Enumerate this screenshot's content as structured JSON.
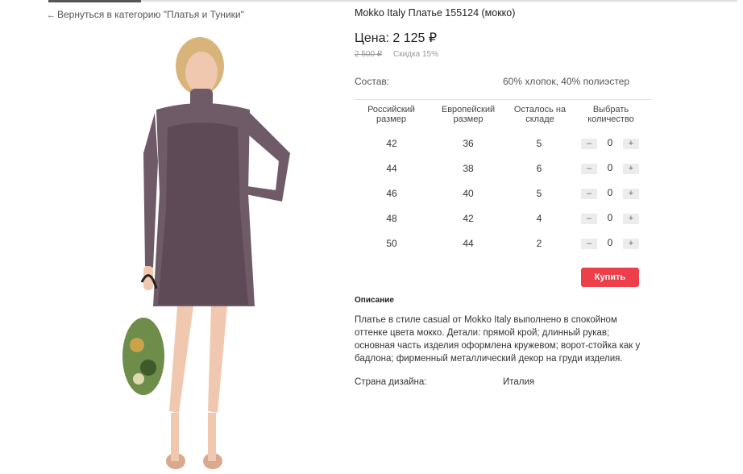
{
  "nav": {
    "back_label": "Вернуться в категорию \"Платья и Туники\""
  },
  "product": {
    "title": "Mokko Italy Платье 155124 (мокко)",
    "price": "Цена: 2 125 ₽",
    "old_price": "2 500 ₽",
    "discount": "Скидка 15%",
    "composition_label": "Состав:",
    "composition_value": "60% хлопок, 40% полиэстер",
    "dress_color": "#6f5a67"
  },
  "sizes_table": {
    "headers": [
      "Российский размер",
      "Европейский размер",
      "Осталось на складе",
      "Выбрать количество"
    ],
    "rows": [
      {
        "ru": "42",
        "eu": "36",
        "stock": "5",
        "qty": "0"
      },
      {
        "ru": "44",
        "eu": "38",
        "stock": "6",
        "qty": "0"
      },
      {
        "ru": "46",
        "eu": "40",
        "stock": "5",
        "qty": "0"
      },
      {
        "ru": "48",
        "eu": "42",
        "stock": "4",
        "qty": "0"
      },
      {
        "ru": "50",
        "eu": "44",
        "stock": "2",
        "qty": "0"
      }
    ],
    "minus_label": "–",
    "plus_label": "+"
  },
  "buy_label": "Купить",
  "buy_color": "#ec3f4a",
  "description": {
    "heading": "Описание",
    "text": "Платье в стиле casual от Mokko Italy выполнено в спокойном оттенке цвета мокко. Детали: прямой крой; длинный рукав; основная часть изделия оформлена кружевом; ворот-стойка как у бадлона; фирменный металлический декор на груди изделия."
  },
  "country": {
    "label": "Страна дизайна:",
    "value": "Италия"
  }
}
